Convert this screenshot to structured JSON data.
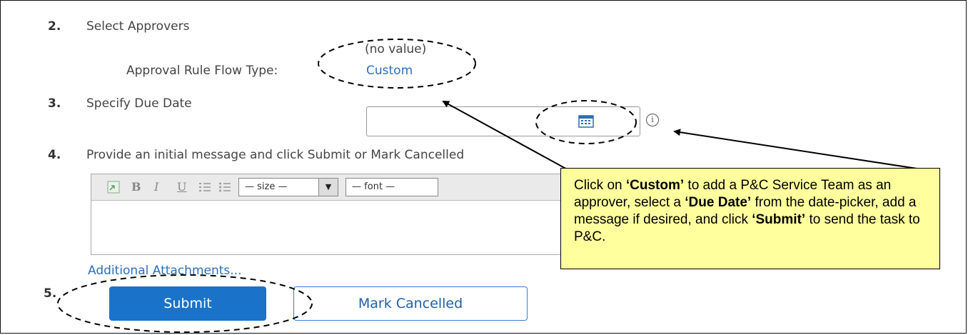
{
  "steps": {
    "s2": {
      "num": "2.",
      "label": "Select Approvers"
    },
    "s3": {
      "num": "3.",
      "label": "Specify Due Date"
    },
    "s4": {
      "num": "4.",
      "label": "Provide an initial message and click Submit or Mark Cancelled"
    },
    "s5": {
      "num": "5."
    }
  },
  "approvers": {
    "no_value": "(no value)",
    "flow_type_label": "Approval Rule Flow Type:",
    "flow_type_value": "Custom"
  },
  "due_date": {
    "value": "",
    "calendar_icon": "calendar-icon",
    "info_icon": "info-icon",
    "info_glyph": "i"
  },
  "editor": {
    "toolbar": {
      "image": "image-icon",
      "bold": "B",
      "italic": "I",
      "underline": "U",
      "ordered": "ordered-list-icon",
      "unordered": "bullet-list-icon",
      "size": "— size —",
      "font": "— font —"
    }
  },
  "attachments_link": "Additional Attachments...",
  "buttons": {
    "submit": "Submit",
    "cancel": "Mark Cancelled"
  },
  "callout": {
    "p1": "Click on ",
    "b1": "‘Custom’",
    "p2": " to add a P&C Service Team as an approver, select a ",
    "b2": "‘Due Date’",
    "p3": " from the date-picker, add a message if desired, and click ",
    "b3": "‘Submit’",
    "p4": " to send the task to P&C."
  },
  "colors": {
    "link": "#2b6fbf",
    "primary_button": "#1a73c9",
    "callout_bg": "#ffff9e"
  }
}
